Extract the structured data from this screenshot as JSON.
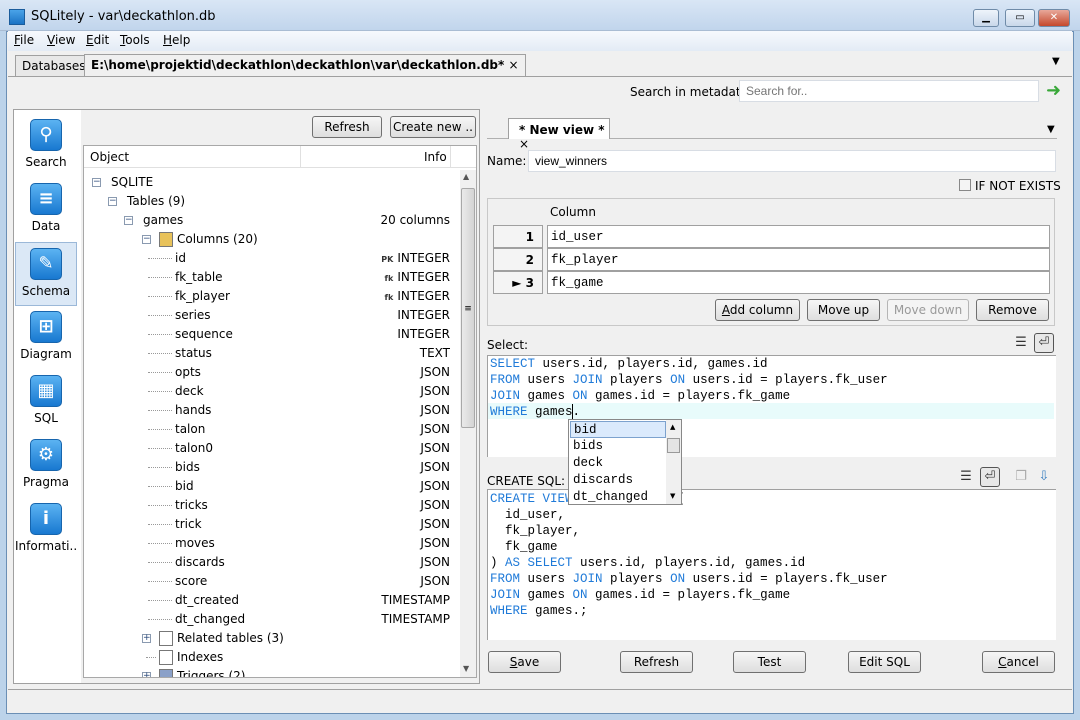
{
  "window": {
    "title": "SQLitely - var\\deckathlon.db",
    "controls": [
      "minimize",
      "maximize",
      "close"
    ]
  },
  "menu": [
    {
      "label": "File",
      "u": "F",
      "rest": "ile"
    },
    {
      "label": "View",
      "u": "V",
      "rest": "iew"
    },
    {
      "label": "Edit",
      "u": "E",
      "rest": "dit"
    },
    {
      "label": "Tools",
      "u": "T",
      "rest": "ools"
    },
    {
      "label": "Help",
      "u": "H",
      "rest": "elp"
    }
  ],
  "tabs": {
    "databases": "Databases",
    "active": "E:\\home\\projektid\\deckathlon\\deckathlon\\var\\deckathlon.db*",
    "close": "×",
    "dropdown": "▼"
  },
  "search": {
    "label": "Search in metadata:",
    "placeholder": "Search for..",
    "go": "➜"
  },
  "sidebar": {
    "items": [
      {
        "label": "Search",
        "icon": "search-icon",
        "glyph": "⚲"
      },
      {
        "label": "Data",
        "icon": "database-icon",
        "glyph": "≡"
      },
      {
        "label": "Schema",
        "icon": "edit-icon",
        "glyph": "✎",
        "selected": true
      },
      {
        "label": "Diagram",
        "icon": "diagram-icon",
        "glyph": "⊞"
      },
      {
        "label": "SQL",
        "icon": "table-icon",
        "glyph": "▦"
      },
      {
        "label": "Pragma",
        "icon": "gear-icon",
        "glyph": "⚙"
      },
      {
        "label": "Informati..",
        "icon": "info-icon",
        "glyph": "i"
      }
    ]
  },
  "schema": {
    "refresh": "Refresh",
    "create_new": "Create new ..",
    "col_object": "Object",
    "col_info": "Info",
    "tree": [
      {
        "label": "SQLITE",
        "level": 0,
        "box": "−"
      },
      {
        "label": "Tables (9)",
        "level": 1,
        "box": "−"
      },
      {
        "label": "games",
        "level": 2,
        "box": "−",
        "info": "20 columns"
      },
      {
        "label": "Columns (20)",
        "level": 3,
        "box": "−",
        "icon": "folder"
      },
      {
        "label": "id",
        "level": 4,
        "key": "PK",
        "info": "INTEGER"
      },
      {
        "label": "fk_table",
        "level": 4,
        "key": "fk",
        "info": "INTEGER"
      },
      {
        "label": "fk_player",
        "level": 4,
        "key": "fk",
        "info": "INTEGER"
      },
      {
        "label": "series",
        "level": 4,
        "info": "INTEGER"
      },
      {
        "label": "sequence",
        "level": 4,
        "info": "INTEGER"
      },
      {
        "label": "status",
        "level": 4,
        "info": "TEXT"
      },
      {
        "label": "opts",
        "level": 4,
        "info": "JSON"
      },
      {
        "label": "deck",
        "level": 4,
        "info": "JSON"
      },
      {
        "label": "hands",
        "level": 4,
        "info": "JSON"
      },
      {
        "label": "talon",
        "level": 4,
        "info": "JSON"
      },
      {
        "label": "talon0",
        "level": 4,
        "info": "JSON"
      },
      {
        "label": "bids",
        "level": 4,
        "info": "JSON"
      },
      {
        "label": "bid",
        "level": 4,
        "info": "JSON"
      },
      {
        "label": "tricks",
        "level": 4,
        "info": "JSON"
      },
      {
        "label": "trick",
        "level": 4,
        "info": "JSON"
      },
      {
        "label": "moves",
        "level": 4,
        "info": "JSON"
      },
      {
        "label": "discards",
        "level": 4,
        "info": "JSON"
      },
      {
        "label": "score",
        "level": 4,
        "info": "JSON"
      },
      {
        "label": "dt_created",
        "level": 4,
        "info": "TIMESTAMP"
      },
      {
        "label": "dt_changed",
        "level": 4,
        "info": "TIMESTAMP"
      },
      {
        "label": "Related tables (3)",
        "level": 3,
        "box": "+",
        "icon": "table"
      },
      {
        "label": "Indexes",
        "level": 3,
        "icon": "page"
      },
      {
        "label": "Triggers (2)",
        "level": 3,
        "box": "+",
        "icon": "trigger"
      }
    ]
  },
  "editor": {
    "tab": "* New view *",
    "tab_close": "×",
    "name_label": "Name:",
    "name_value": "view_winners",
    "if_not_exists": "IF NOT EXISTS",
    "if_not_exists_checked": false,
    "column_header": "Column",
    "columns": [
      {
        "num": "1",
        "name": "id_user"
      },
      {
        "num": "2",
        "name": "fk_player"
      },
      {
        "num": "► 3",
        "name": "fk_game"
      }
    ],
    "add_column": "Add column",
    "move_up": "Move up",
    "move_down": "Move down",
    "remove": "Remove",
    "select_label": "Select:",
    "select_sql": [
      [
        [
          "kw",
          "SELECT"
        ],
        [
          "t",
          " users.id, players.id, games.id"
        ]
      ],
      [
        [
          "kw",
          "FROM"
        ],
        [
          "t",
          " users "
        ],
        [
          "kw",
          "JOIN"
        ],
        [
          "t",
          " players "
        ],
        [
          "kw",
          "ON"
        ],
        [
          "t",
          " users.id = players.fk_user"
        ]
      ],
      [
        [
          "kw",
          "JOIN"
        ],
        [
          "t",
          " games "
        ],
        [
          "kw",
          "ON"
        ],
        [
          "t",
          " games.id = players.fk_game"
        ]
      ],
      [
        [
          "kw",
          "WHERE"
        ],
        [
          "t",
          " games."
        ]
      ]
    ],
    "autocomplete": [
      "bid",
      "bids",
      "deck",
      "discards",
      "dt_changed"
    ],
    "create_label": "CREATE SQL:",
    "create_sql": [
      [
        [
          "kw",
          "CREATE VIEW"
        ],
        [
          "t",
          " view_winners ("
        ]
      ],
      [
        [
          "t",
          "  id_user,"
        ]
      ],
      [
        [
          "t",
          "  fk_player,"
        ]
      ],
      [
        [
          "t",
          "  fk_game"
        ]
      ],
      [
        [
          "t",
          ") "
        ],
        [
          "kw",
          "AS SELECT"
        ],
        [
          "t",
          " users.id, players.id, games.id"
        ]
      ],
      [
        [
          "kw",
          "FROM"
        ],
        [
          "t",
          " users "
        ],
        [
          "kw",
          "JOIN"
        ],
        [
          "t",
          " players "
        ],
        [
          "kw",
          "ON"
        ],
        [
          "t",
          " users.id = players.fk_user"
        ]
      ],
      [
        [
          "kw",
          "JOIN"
        ],
        [
          "t",
          " games "
        ],
        [
          "kw",
          "ON"
        ],
        [
          "t",
          " games.id = players.fk_game"
        ]
      ],
      [
        [
          "kw",
          "WHERE"
        ],
        [
          "t",
          " games.;"
        ]
      ]
    ],
    "buttons": {
      "save": "Save",
      "refresh": "Refresh",
      "test": "Test",
      "edit_sql": "Edit SQL",
      "cancel": "Cancel"
    }
  },
  "colors": {
    "keyword": "#1f7ad8",
    "current_line": "#e8fbfb",
    "selection": "#dbeafc"
  }
}
